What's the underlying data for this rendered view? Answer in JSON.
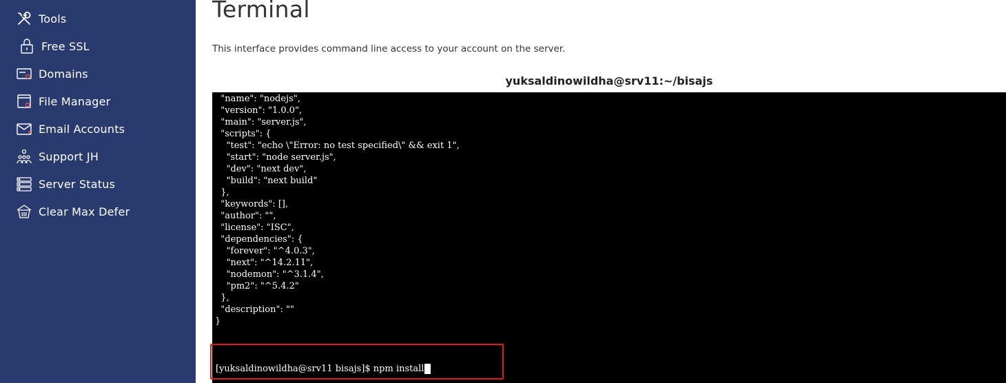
{
  "sidebar": {
    "items": [
      {
        "label": "Tools",
        "icon": "tools-icon"
      },
      {
        "label": "Free SSL",
        "icon": "lock-icon"
      },
      {
        "label": "Domains",
        "icon": "domains-icon"
      },
      {
        "label": "File Manager",
        "icon": "file-manager-icon"
      },
      {
        "label": "Email Accounts",
        "icon": "email-icon"
      },
      {
        "label": "Support JH",
        "icon": "support-users-icon"
      },
      {
        "label": "Server Status",
        "icon": "server-icon"
      },
      {
        "label": "Clear Max Defer",
        "icon": "basket-icon"
      }
    ]
  },
  "main": {
    "title": "Terminal",
    "description": "This interface provides command line access to your account on the server.",
    "terminal": {
      "header": "yuksaldinowildha@srv11:~/bisajs",
      "output": "  \"name\": \"nodejs\",\n  \"version\": \"1.0.0\",\n  \"main\": \"server.js\",\n  \"scripts\": {\n    \"test\": \"echo \\\"Error: no test specified\\\" && exit 1\",\n    \"start\": \"node server.js\",\n    \"dev\": \"next dev\",\n    \"build\": \"next build\"\n  },\n  \"keywords\": [],\n  \"author\": \"\",\n  \"license\": \"ISC\",\n  \"dependencies\": {\n    \"forever\": \"^4.0.3\",\n    \"next\": \"^14.2.11\",\n    \"nodemon\": \"^3.1.4\",\n    \"pm2\": \"^5.4.2\"\n  },\n  \"description\": \"\"\n}",
      "prompt": "[yuksaldinowildha@srv11 bisajs]$ npm install",
      "highlight_color": "#e3171e"
    }
  },
  "colors": {
    "sidebar_bg": "#293a6e",
    "terminal_bg": "#000000"
  }
}
